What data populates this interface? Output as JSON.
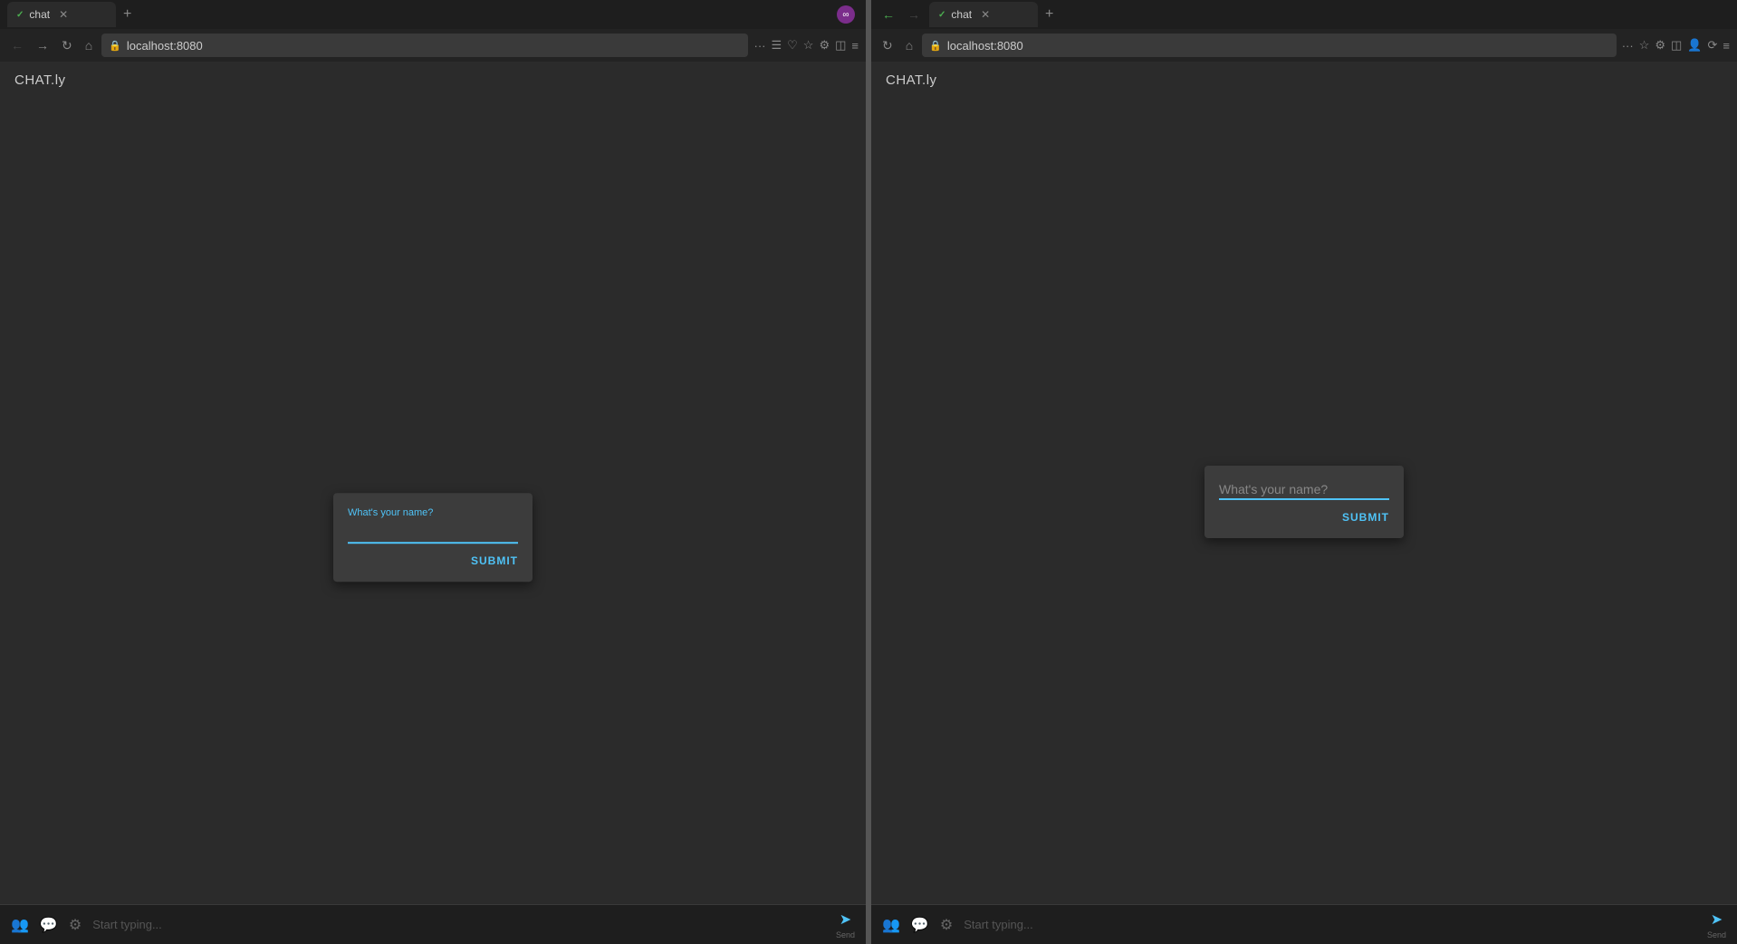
{
  "left_browser": {
    "tab_title": "chat",
    "favicon": "✓",
    "url": "localhost:8080",
    "app_title": "CHAT.ly",
    "dialog": {
      "label": "What's your name?",
      "input_value": "",
      "input_placeholder": "",
      "submit_label": "SUBMIT"
    },
    "bottom_bar": {
      "input_placeholder": "Start typing...",
      "send_label": "Send"
    }
  },
  "right_browser": {
    "tab_title": "chat",
    "favicon": "✓",
    "url": "localhost:8080",
    "app_title": "CHAT.ly",
    "dialog": {
      "label": "What's your name?",
      "input_placeholder": "What's your name?",
      "submit_label": "SUBMIT"
    },
    "bottom_bar": {
      "input_placeholder": "Start typing...",
      "send_label": "Send"
    }
  },
  "icons": {
    "back": "←",
    "forward": "→",
    "reload": "↻",
    "home": "⌂",
    "lock": "🔒",
    "more": "···",
    "bookmark": "☆",
    "star": "★",
    "share": "⬆",
    "send": "➤",
    "users": "👥",
    "chat_bubble": "💬",
    "settings": "⚙"
  }
}
